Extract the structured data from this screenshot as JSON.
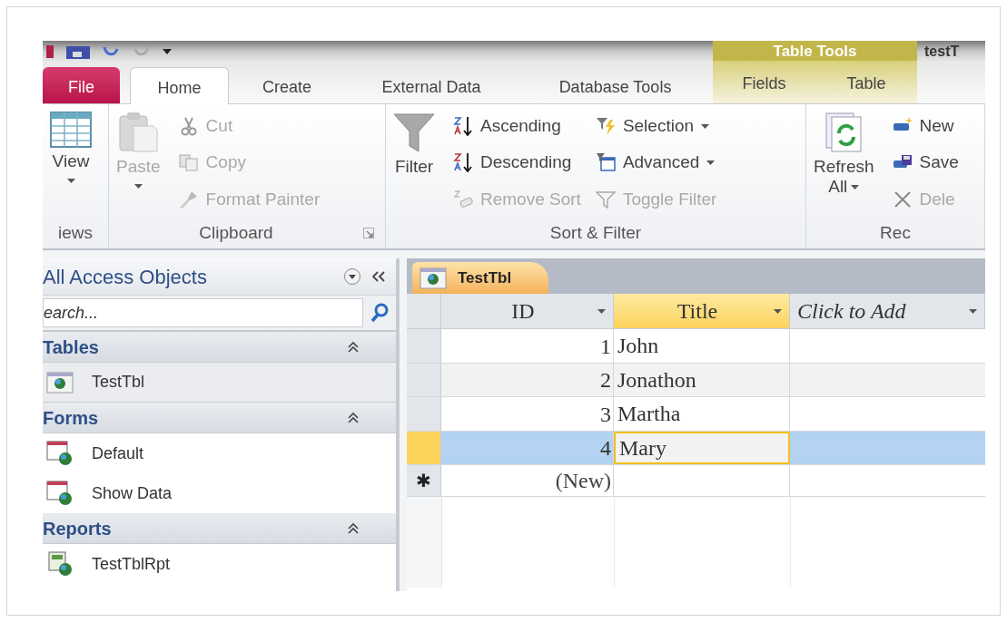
{
  "title_bar": {
    "document_title": "testT",
    "contextual_group": "Table Tools"
  },
  "tabs": [
    {
      "label": "File",
      "kind": "file",
      "selected": false
    },
    {
      "label": "Home",
      "kind": "tab",
      "selected": true
    },
    {
      "label": "Create",
      "kind": "tab",
      "selected": false
    },
    {
      "label": "External Data",
      "kind": "tab",
      "selected": false
    },
    {
      "label": "Database Tools",
      "kind": "tab",
      "selected": false
    },
    {
      "label": "Fields",
      "kind": "contextual",
      "selected": false
    },
    {
      "label": "Table",
      "kind": "contextual",
      "selected": false
    }
  ],
  "ribbon_groups": [
    {
      "label": "iews",
      "launcher": false,
      "columns": [
        {
          "kind": "large",
          "items": [
            {
              "label": "View",
              "disabled": false,
              "dropdown": true
            }
          ]
        }
      ]
    },
    {
      "label": "Clipboard",
      "launcher": true,
      "columns": [
        {
          "kind": "large",
          "items": [
            {
              "label": "Paste",
              "disabled": true,
              "dropdown": true
            }
          ]
        },
        {
          "kind": "stack",
          "items": [
            {
              "label": "Cut",
              "disabled": true,
              "dropdown": false
            },
            {
              "label": "Copy",
              "disabled": true,
              "dropdown": false
            },
            {
              "label": "Format Painter",
              "disabled": true,
              "dropdown": false
            }
          ]
        }
      ]
    },
    {
      "label": "Sort & Filter",
      "launcher": false,
      "columns": [
        {
          "kind": "large",
          "items": [
            {
              "label": "Filter",
              "disabled": false,
              "dropdown": false
            }
          ]
        },
        {
          "kind": "stack",
          "items": [
            {
              "label": "Ascending",
              "disabled": false,
              "dropdown": false
            },
            {
              "label": "Descending",
              "disabled": false,
              "dropdown": false
            },
            {
              "label": "Remove Sort",
              "disabled": true,
              "dropdown": false
            }
          ]
        },
        {
          "kind": "stack",
          "items": [
            {
              "label": "Selection",
              "disabled": false,
              "dropdown": true
            },
            {
              "label": "Advanced",
              "disabled": false,
              "dropdown": true
            },
            {
              "label": "Toggle Filter",
              "disabled": true,
              "dropdown": false
            }
          ]
        }
      ]
    },
    {
      "label": "Rec",
      "launcher": false,
      "columns": [
        {
          "kind": "large",
          "items": [
            {
              "label": "Refresh",
              "label2": "All",
              "disabled": false,
              "dropdown": true
            }
          ]
        },
        {
          "kind": "stack",
          "items": [
            {
              "label": "New",
              "disabled": false,
              "dropdown": false
            },
            {
              "label": "Save",
              "disabled": false,
              "dropdown": false
            },
            {
              "label": "Dele",
              "disabled": true,
              "dropdown": false
            }
          ]
        }
      ]
    }
  ],
  "nav_pane": {
    "title": "All Access Objects",
    "search": {
      "placeholder": "earch..."
    },
    "sections": [
      {
        "label": "Tables",
        "expanded": true,
        "items": [
          {
            "label": "TestTbl",
            "selected": true
          }
        ]
      },
      {
        "label": "Forms",
        "expanded": true,
        "items": [
          {
            "label": "Default",
            "selected": false
          },
          {
            "label": "Show Data",
            "selected": false
          }
        ]
      },
      {
        "label": "Reports",
        "expanded": true,
        "items": [
          {
            "label": "TestTblRpt",
            "selected": false
          }
        ]
      }
    ]
  },
  "document_tabs": [
    {
      "label": "TestTbl",
      "selected": true
    }
  ],
  "datasheet": {
    "columns": [
      {
        "label": "ID",
        "kind": "field",
        "selected": false
      },
      {
        "label": "Title",
        "kind": "field",
        "selected": true
      },
      {
        "label": "Click to Add",
        "kind": "add",
        "selected": false
      }
    ],
    "rows": [
      {
        "id": "1",
        "title": "John",
        "selected": false
      },
      {
        "id": "2",
        "title": "Jonathon",
        "selected": false
      },
      {
        "id": "3",
        "title": "Martha",
        "selected": false
      },
      {
        "id": "4",
        "title": "Mary",
        "selected": true
      }
    ],
    "new_row": {
      "marker": "✱",
      "id": "(New)"
    }
  }
}
